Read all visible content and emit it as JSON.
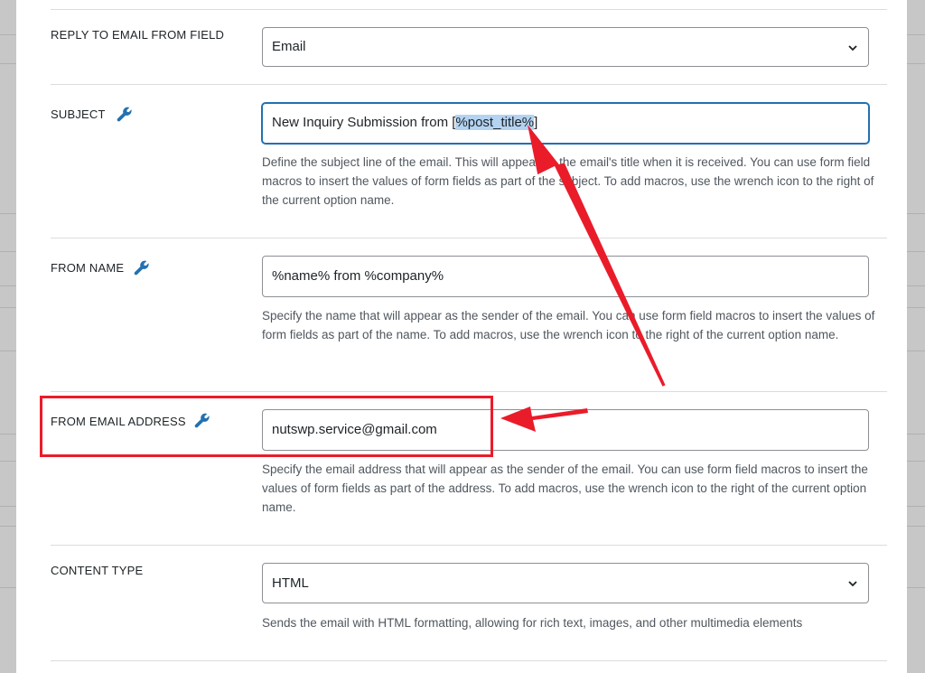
{
  "settings": {
    "reply_to": {
      "label": "REPLY TO EMAIL FROM FIELD",
      "value": "Email"
    },
    "subject": {
      "label": "SUBJECT",
      "value_prefix": "New Inquiry Submission from [",
      "value_highlight": "%post_title%",
      "value_suffix": "]",
      "help": "Define the subject line of the email. This will appear as the email's title when it is received. You can use form field macros to insert the values of form fields as part of the subject. To add macros, use the wrench icon to the right of the current option name."
    },
    "from_name": {
      "label": "FROM NAME",
      "value": "%name% from %company%",
      "help": "Specify the name that will appear as the sender of the email. You can use form field macros to insert the values of form fields as part of the name. To add macros, use the wrench icon to the right of the current option name."
    },
    "from_email": {
      "label": "FROM EMAIL ADDRESS",
      "value": "nutswp.service@gmail.com",
      "help": "Specify the email address that will appear as the sender of the email. You can use form field macros to insert the values of form fields as part of the address. To add macros, use the wrench icon to the right of the current option name."
    },
    "content_type": {
      "label": "CONTENT TYPE",
      "value": "HTML",
      "help": "Sends the email with HTML formatting, allowing for rich text, images, and other multimedia elements"
    }
  },
  "icons": {
    "wrench": "wrench-icon",
    "chevron": "chevron-down-icon"
  },
  "colors": {
    "annotation_red": "#ea1c2a",
    "focus_blue": "#2271b1",
    "wrench_blue": "#2271b1",
    "selection_highlight": "#b4d3f2"
  }
}
